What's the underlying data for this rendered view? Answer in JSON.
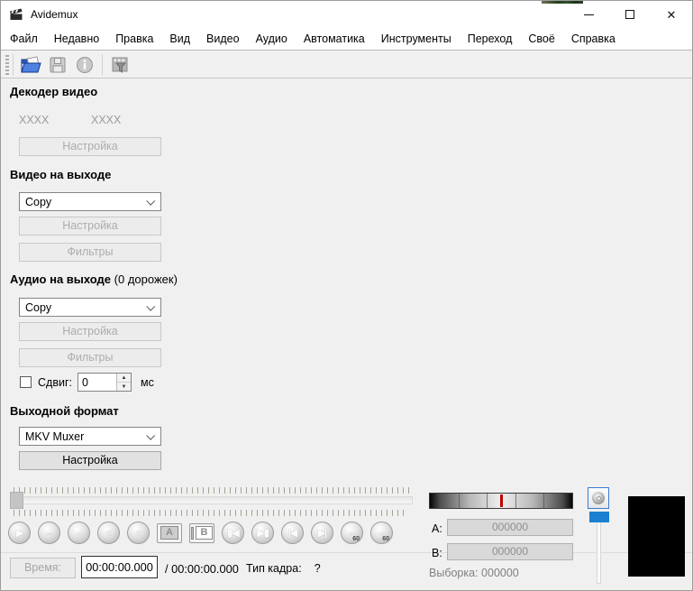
{
  "window": {
    "title": "Avidemux"
  },
  "menu": {
    "items": [
      "Файл",
      "Недавно",
      "Правка",
      "Вид",
      "Видео",
      "Аудио",
      "Автоматика",
      "Инструменты",
      "Переход",
      "Своё",
      "Справка"
    ]
  },
  "decoder": {
    "title": "Декодер видео",
    "left_placeholder": "XXXX",
    "right_placeholder": "XXXX",
    "configure": "Настройка"
  },
  "video_out": {
    "title": "Видео на выходе",
    "codec": "Copy",
    "configure": "Настройка",
    "filters": "Фильтры"
  },
  "audio_out": {
    "title": "Аудио на выходе",
    "tracks_suffix": "(0 дорожек)",
    "codec": "Copy",
    "configure": "Настройка",
    "filters": "Фильтры",
    "shift_label": "Сдвиг:",
    "shift_value": "0",
    "shift_unit": "мс"
  },
  "format": {
    "title": "Выходной формат",
    "muxer": "MKV Muxer",
    "configure": "Настройка"
  },
  "transport": {
    "buttons": [
      {
        "name": "play",
        "glyph": "▶"
      },
      {
        "name": "previous-frame",
        "glyph": "←"
      },
      {
        "name": "next-frame",
        "glyph": "→"
      },
      {
        "name": "rewind",
        "glyph": "«"
      },
      {
        "name": "fast-forward",
        "glyph": "»"
      },
      {
        "name": "set-marker-a",
        "glyph": "A"
      },
      {
        "name": "set-marker-b",
        "glyph": "B"
      },
      {
        "name": "previous-black-frame",
        "glyph": "▮◀"
      },
      {
        "name": "next-black-frame",
        "glyph": "▶▮"
      },
      {
        "name": "previous-keyframe",
        "glyph": "|◀"
      },
      {
        "name": "next-keyframe",
        "glyph": "▶|"
      },
      {
        "name": "back-60",
        "glyph": "←",
        "sub": "60"
      },
      {
        "name": "forward-60",
        "glyph": "→",
        "sub": "60"
      }
    ]
  },
  "status": {
    "time_button": "Время:",
    "current_time": "00:00:00.000",
    "total_time": "/ 00:00:00.000",
    "frame_type_label": "Тип кадра:",
    "frame_type_value": "?"
  },
  "selection": {
    "a_label": "A:",
    "a_value": "000000",
    "b_label": "B:",
    "b_value": "000000",
    "sample_label": "Выборка:",
    "sample_value": "000000"
  },
  "colors": {
    "accent_blue": "#1a80cf",
    "marker_red": "#c40000",
    "open_folder_blue": "#2d5bb9"
  }
}
